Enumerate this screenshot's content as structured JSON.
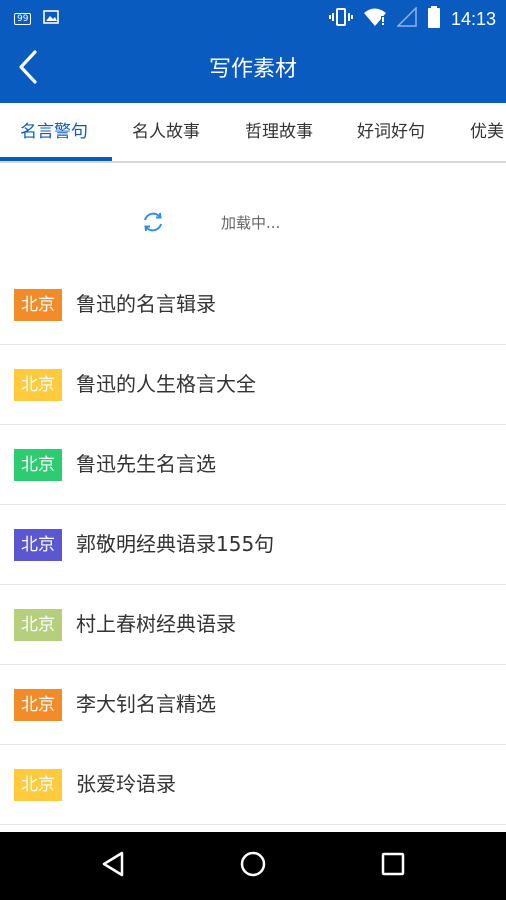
{
  "status_bar": {
    "notification_badge": "99",
    "time": "14:13",
    "icons": [
      "notification-99-icon",
      "image-icon",
      "vibrate-icon",
      "wifi-icon",
      "signal-icon",
      "battery-icon"
    ]
  },
  "app_bar": {
    "title": "写作素材",
    "back_icon": "back-chevron-icon"
  },
  "tabs": [
    {
      "label": "名言警句",
      "active": true
    },
    {
      "label": "名人故事",
      "active": false
    },
    {
      "label": "哲理故事",
      "active": false
    },
    {
      "label": "好词好句",
      "active": false
    },
    {
      "label": "优美",
      "active": false
    }
  ],
  "loading": {
    "text": "加载中...",
    "icon": "refresh-spinner-icon"
  },
  "list": [
    {
      "badge": "北京",
      "badge_color": "#f28c28",
      "title": "鲁迅的名言辑录"
    },
    {
      "badge": "北京",
      "badge_color": "#ffcb3c",
      "title": "鲁迅的人生格言大全"
    },
    {
      "badge": "北京",
      "badge_color": "#2ecc71",
      "title": "鲁迅先生名言选"
    },
    {
      "badge": "北京",
      "badge_color": "#5b57d1",
      "title": "郭敬明经典语录155句"
    },
    {
      "badge": "北京",
      "badge_color": "#b5cf7d",
      "title": "村上春树经典语录"
    },
    {
      "badge": "北京",
      "badge_color": "#f28c28",
      "title": "李大钊名言精选"
    },
    {
      "badge": "北京",
      "badge_color": "#ffcb3c",
      "title": "张爱玲语录"
    }
  ],
  "nav_bar": {
    "icons": [
      "back-triangle-icon",
      "home-circle-icon",
      "recents-square-icon"
    ]
  },
  "colors": {
    "primary": "#0a5bc0",
    "text": "#333333",
    "divider": "#e6e6e6"
  }
}
